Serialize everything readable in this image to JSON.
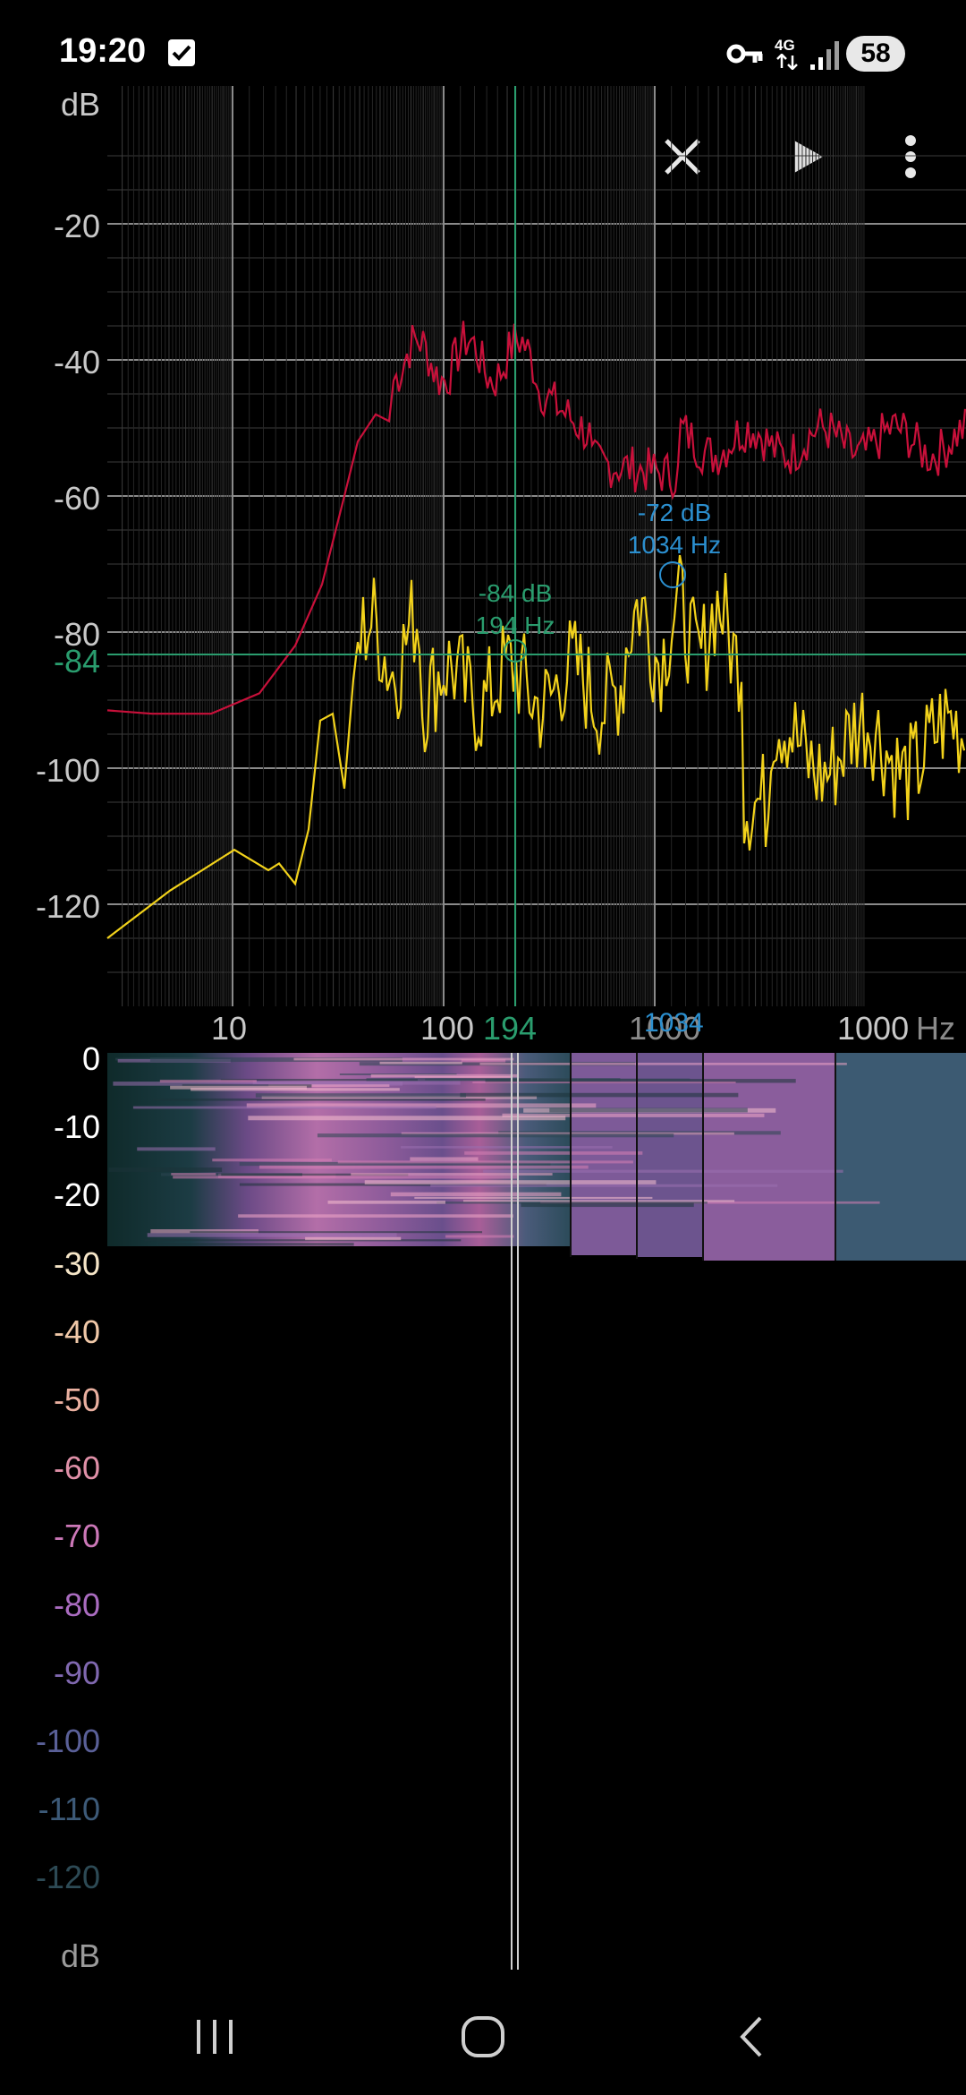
{
  "status_bar": {
    "time": "19:20",
    "network": "4G",
    "battery": "58",
    "icons": [
      "checkbox-notification-icon",
      "vpn-key-icon",
      "signal-icon"
    ]
  },
  "toolbar": {
    "icons": [
      "close-icon",
      "play-icon",
      "more-vert-icon"
    ]
  },
  "spectrum": {
    "y_unit": "dB",
    "x_unit": "Hz",
    "y_ticks": [
      "-20",
      "-40",
      "-60",
      "-80",
      "-100",
      "-120"
    ],
    "x_ticks": [
      "10",
      "100",
      "1000",
      "1000"
    ],
    "cursor": {
      "level_label": "-84",
      "freq_label": "194",
      "db_readout": "-84 dB",
      "hz_readout": "194 Hz"
    },
    "peak": {
      "db_readout": "-72 dB",
      "hz_readout": "1034 Hz",
      "freq_label": "1034"
    },
    "colors": {
      "peak_hold": "#c8103a",
      "live": "#f2d21b",
      "cursor": "#2a9d6e",
      "peak_marker": "#2b8fcf",
      "grid": "#555555"
    }
  },
  "spectrogram": {
    "scale_unit": "dB",
    "scale_ticks": [
      "0",
      "-10",
      "-20",
      "-30",
      "-40",
      "-50",
      "-60",
      "-70",
      "-80",
      "-90",
      "-100",
      "-110",
      "-120"
    ],
    "tick_colors": [
      "#ffffff",
      "#ffffff",
      "#ffffff",
      "#f6e6c8",
      "#f0c8a8",
      "#eab0a0",
      "#e090a8",
      "#cc78b8",
      "#aa6cc0",
      "#8068b0",
      "#5a6098",
      "#3d5a78",
      "#2d4a55"
    ]
  },
  "nav_bar": {
    "icons": [
      "recent-apps-icon",
      "home-icon",
      "back-icon"
    ]
  }
}
